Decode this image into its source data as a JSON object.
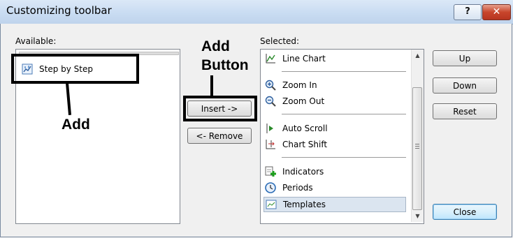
{
  "window": {
    "title": "Customizing toolbar",
    "help_glyph": "?",
    "close_glyph": "✕"
  },
  "available": {
    "label": "Available:",
    "items": [
      {
        "label": "Step by Step",
        "icon": "step-by-step-icon"
      }
    ]
  },
  "selected": {
    "label": "Selected:",
    "items": [
      {
        "label": "Line Chart",
        "icon": "line-chart-icon"
      },
      {
        "label": "Zoom In",
        "icon": "zoom-in-icon"
      },
      {
        "label": "Zoom Out",
        "icon": "zoom-out-icon"
      },
      {
        "label": "Auto Scroll",
        "icon": "auto-scroll-icon"
      },
      {
        "label": "Chart Shift",
        "icon": "chart-shift-icon"
      },
      {
        "label": "Indicators",
        "icon": "indicators-icon"
      },
      {
        "label": "Periods",
        "icon": "periods-icon"
      },
      {
        "label": "Templates",
        "icon": "templates-icon",
        "selected": true
      }
    ]
  },
  "buttons": {
    "insert": "Insert ->",
    "remove": "<- Remove",
    "up": "Up",
    "down": "Down",
    "reset": "Reset",
    "close": "Close"
  },
  "annotations": {
    "add_button_line1": "Add",
    "add_button_line2": "Button",
    "add": "Add"
  },
  "colors": {
    "selection": "#dbe5f0",
    "annotation": "#000000"
  }
}
